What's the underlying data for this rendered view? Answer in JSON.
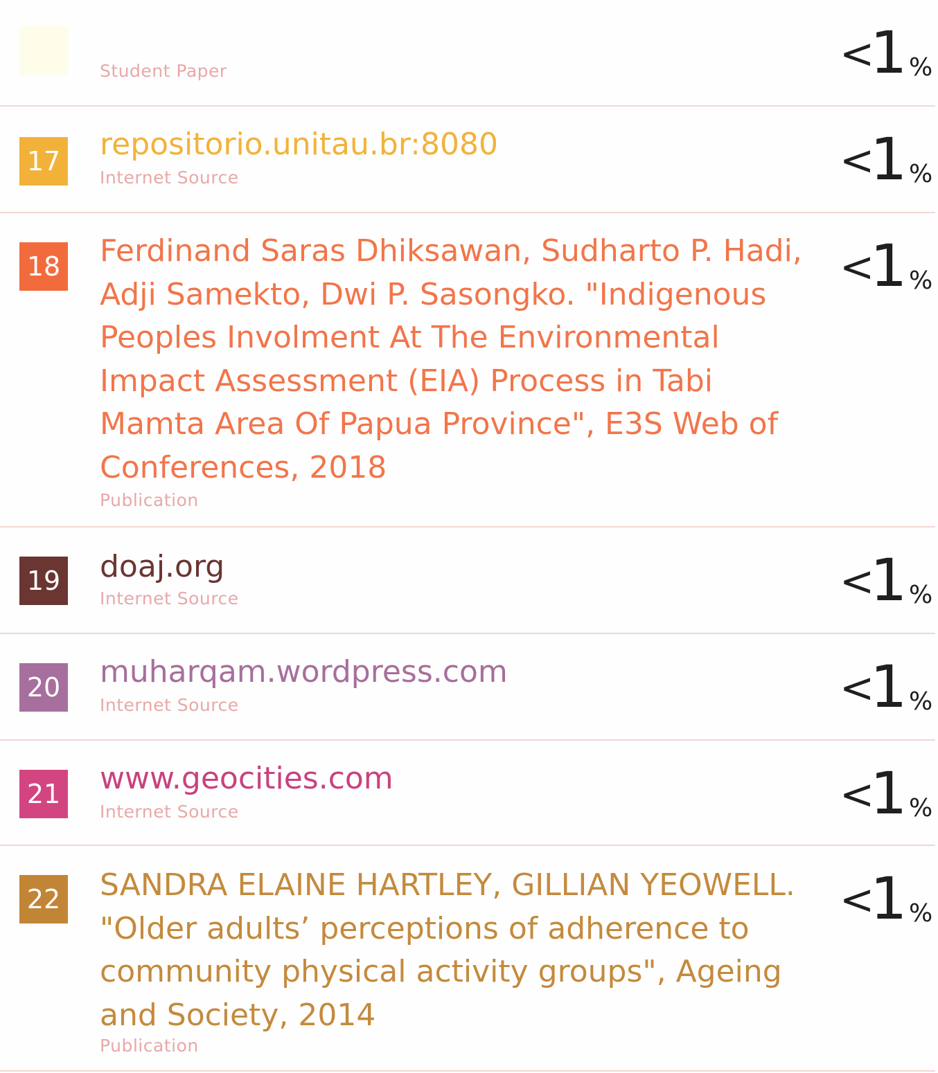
{
  "sources": [
    {
      "number": "",
      "title_lines": [],
      "type": "Student Paper",
      "percent": {
        "prefix": "<",
        "value": "1",
        "unit": "%"
      },
      "color": "#fdfde9",
      "title_color": "#e9a8a8"
    },
    {
      "number": "17",
      "title_lines": [
        "repositorio.unitau.br:8080"
      ],
      "type": "Internet Source",
      "percent": {
        "prefix": "<",
        "value": "1",
        "unit": "%"
      },
      "color": "#f2b23a",
      "title_color": "#f2b23a"
    },
    {
      "number": "18",
      "title_lines": [
        "Ferdinand Saras Dhiksawan, Sudharto P. Hadi,",
        "Adji Samekto, Dwi P. Sasongko. \"Indigenous",
        "Peoples Involment At The Environmental",
        "Impact Assessment (EIA) Process in Tabi",
        "Mamta Area Of Papua Province\", E3S Web of",
        "Conferences, 2018"
      ],
      "type": "Publication",
      "percent": {
        "prefix": "<",
        "value": "1",
        "unit": "%"
      },
      "color": "#f26b3c",
      "title_color": "#f2754a"
    },
    {
      "number": "19",
      "title_lines": [
        "doaj.org"
      ],
      "type": "Internet Source",
      "percent": {
        "prefix": "<",
        "value": "1",
        "unit": "%"
      },
      "color": "#6b3532",
      "title_color": "#6b3532"
    },
    {
      "number": "20",
      "title_lines": [
        "muharqam.wordpress.com"
      ],
      "type": "Internet Source",
      "percent": {
        "prefix": "<",
        "value": "1",
        "unit": "%"
      },
      "color": "#a66f9d",
      "title_color": "#a66f9d"
    },
    {
      "number": "21",
      "title_lines": [
        "www.geocities.com"
      ],
      "type": "Internet Source",
      "percent": {
        "prefix": "<",
        "value": "1",
        "unit": "%"
      },
      "color": "#d24581",
      "title_color": "#c8427f"
    },
    {
      "number": "22",
      "title_lines": [
        "SANDRA ELAINE HARTLEY, GILLIAN YEOWELL.",
        "\"Older adults’ perceptions of adherence to",
        "community physical activity groups\", Ageing",
        "and Society, 2014"
      ],
      "type": "Publication",
      "percent": {
        "prefix": "<",
        "value": "1",
        "unit": "%"
      },
      "color": "#c28535",
      "title_color": "#c48a3c"
    }
  ]
}
